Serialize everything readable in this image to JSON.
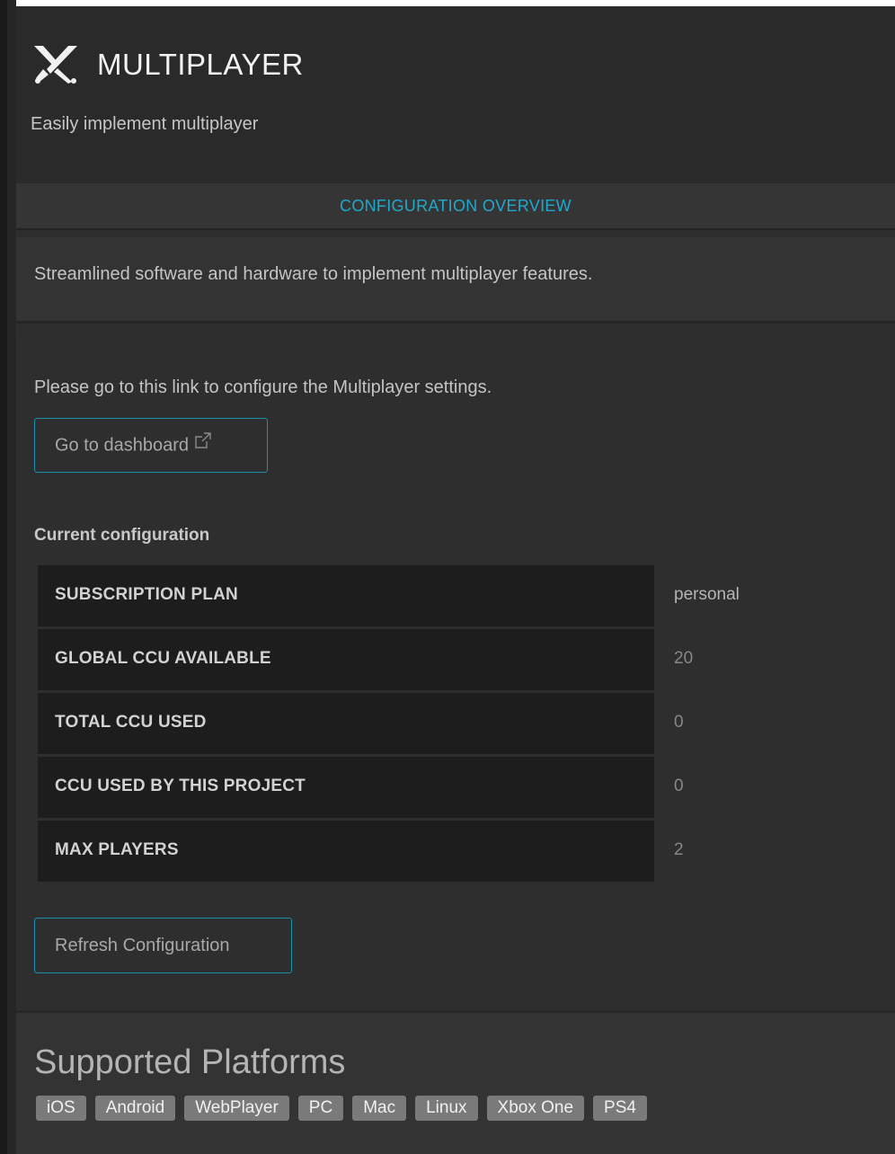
{
  "header": {
    "icon": "crossed-swords-icon",
    "title": "MULTIPLAYER",
    "subtitle": "Easily implement multiplayer"
  },
  "tabbar": {
    "active_tab": "CONFIGURATION OVERVIEW",
    "accent_color": "#1fa9cf"
  },
  "description": "Streamlined software and hardware to implement multiplayer features.",
  "config_section": {
    "link_text": "Please go to this link to configure the Multiplayer settings.",
    "dashboard_button": "Go to dashboard",
    "dashboard_button_icon": "external-link-icon",
    "current_config_label": "Current configuration",
    "rows": [
      {
        "key": "SUBSCRIPTION PLAN",
        "value": "personal"
      },
      {
        "key": "GLOBAL CCU AVAILABLE",
        "value": "20"
      },
      {
        "key": "TOTAL CCU USED",
        "value": "0"
      },
      {
        "key": "CCU USED BY THIS PROJECT",
        "value": "0"
      },
      {
        "key": "MAX PLAYERS",
        "value": "2"
      }
    ],
    "refresh_button": "Refresh Configuration"
  },
  "platforms": {
    "title": "Supported Platforms",
    "items": [
      "iOS",
      "Android",
      "WebPlayer",
      "PC",
      "Mac",
      "Linux",
      "Xbox One",
      "PS4"
    ]
  }
}
